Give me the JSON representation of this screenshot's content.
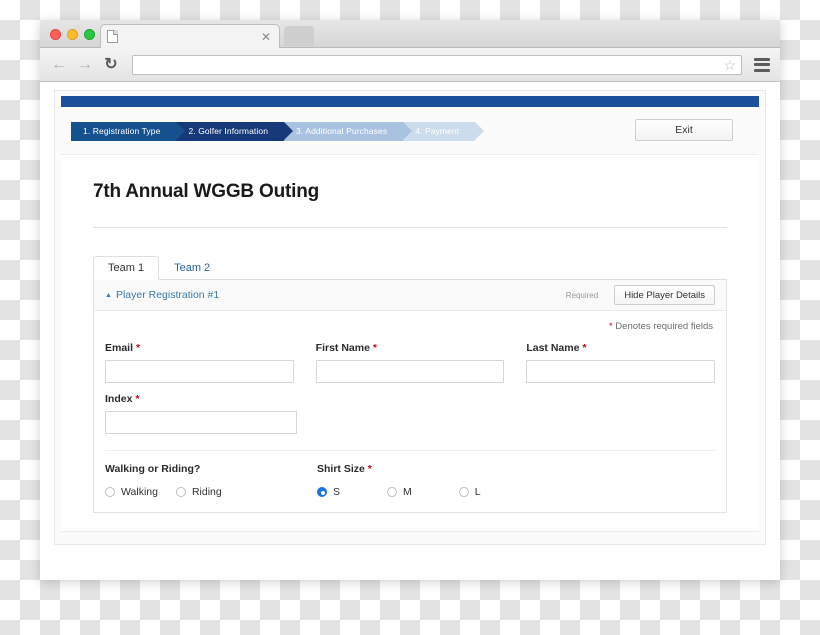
{
  "browser": {
    "tab_title": "",
    "url": "",
    "icons": {
      "back": "back-arrow-icon",
      "forward": "forward-arrow-icon",
      "reload": "reload-icon",
      "bookmark": "star-icon",
      "menu": "hamburger-menu-icon",
      "close_tab": "close-icon"
    }
  },
  "brand_color": "#1a5099",
  "accent_color": "#1a73e8",
  "required_color": "#d0021b",
  "steps": [
    {
      "label": "1. Registration Type",
      "state": "completed"
    },
    {
      "label": "2. Golfer Information",
      "state": "active"
    },
    {
      "label": "3. Additional Purchases",
      "state": "upcoming"
    },
    {
      "label": "4. Payment",
      "state": "upcoming"
    }
  ],
  "exit_button": "Exit",
  "page_title": "7th Annual WGGB Outing",
  "team_tabs": [
    {
      "label": "Team 1",
      "active": true
    },
    {
      "label": "Team 2",
      "active": false
    }
  ],
  "panel": {
    "caret": "▲",
    "title": "Player Registration #1",
    "required_tag": "Required",
    "hide_button": "Hide Player Details",
    "denotes_prefix": "*",
    "denotes_text": "Denotes required fields"
  },
  "fields": [
    {
      "label": "Email",
      "required": true,
      "value": ""
    },
    {
      "label": "First Name",
      "required": true,
      "value": ""
    },
    {
      "label": "Last Name",
      "required": true,
      "value": ""
    },
    {
      "label": "Index",
      "required": true,
      "value": ""
    }
  ],
  "radio_groups": [
    {
      "label": "Walking or Riding?",
      "required": false,
      "options": [
        {
          "label": "Walking",
          "selected": false
        },
        {
          "label": "Riding",
          "selected": false
        }
      ]
    },
    {
      "label": "Shirt Size",
      "required": true,
      "options": [
        {
          "label": "S",
          "selected": true
        },
        {
          "label": "M",
          "selected": false
        },
        {
          "label": "L",
          "selected": false
        }
      ]
    }
  ],
  "asterisk": "*"
}
